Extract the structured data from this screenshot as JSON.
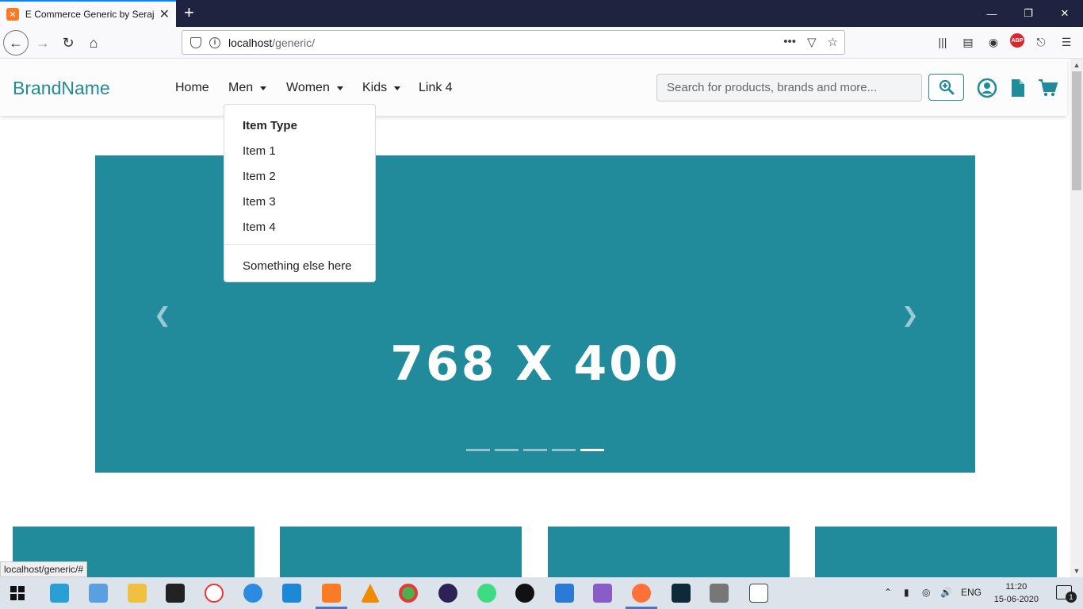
{
  "browser": {
    "tab_title": "E Commerce Generic by Seraj K",
    "url_host": "localhost",
    "url_path": "/generic/",
    "status_url": "localhost/generic/#"
  },
  "site": {
    "brand": "BrandName",
    "nav": {
      "home": "Home",
      "men": "Men",
      "women": "Women",
      "kids": "Kids",
      "link4": "Link 4"
    },
    "search_placeholder": "Search for products, brands and more...",
    "dropdown": {
      "header": "Item Type",
      "items": [
        "Item 1",
        "Item 2",
        "Item 3",
        "Item 4"
      ],
      "extra": "Something else here"
    },
    "carousel": {
      "text": "768 X 400",
      "slides": 5,
      "active_index": 4
    },
    "colors": {
      "accent": "#218b9c",
      "brand": "#218b98"
    }
  },
  "taskbar": {
    "language": "ENG",
    "time": "11:20",
    "date": "15-06-2020",
    "notifications": "1"
  }
}
